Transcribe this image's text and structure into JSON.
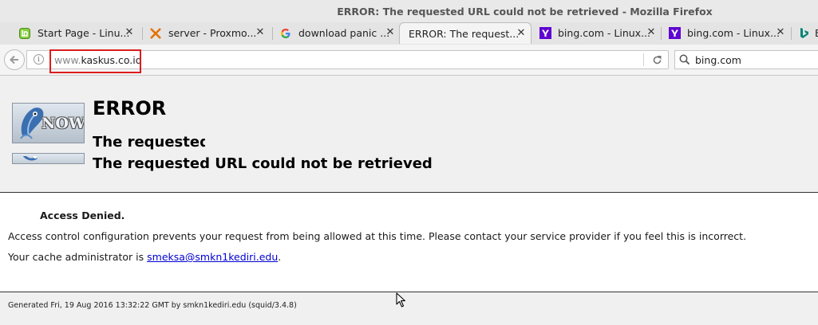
{
  "window": {
    "title": "ERROR: The requested URL could not be retrieved - Mozilla Firefox"
  },
  "tabs": [
    {
      "label": "Start Page - Linu...",
      "icon": "linux-mint-icon",
      "active": false
    },
    {
      "label": "server - Proxmo...",
      "icon": "proxmox-icon",
      "active": false
    },
    {
      "label": "download panic ...",
      "icon": "google-icon",
      "active": false
    },
    {
      "label": "ERROR: The request...",
      "icon": "none",
      "active": true
    },
    {
      "label": "bing.com - Linux...",
      "icon": "yahoo-icon",
      "active": false
    },
    {
      "label": "bing.com - Linux...",
      "icon": "yahoo-icon",
      "active": false
    },
    {
      "label": "B",
      "icon": "bing-icon",
      "active": false
    }
  ],
  "tab_close_glyph": "✕",
  "nav": {
    "url_prefix": "www.",
    "url_host": "kaskus.co.id",
    "search_value": "bing.com"
  },
  "page": {
    "heading": "ERROR",
    "subheading_clipped": "The requested URL could not be retrieved",
    "subheading": "The requested URL could not be retrieved",
    "logo_text": "NOW",
    "denied": "Access Denied.",
    "message": "Access control configuration prevents your request from being allowed at this time. Please contact your service provider if you feel this is incorrect.",
    "admin_prefix": "Your cache administrator is ",
    "admin_email": "smeksa@smkn1kediri.edu",
    "admin_suffix": ".",
    "footer": "Generated Fri, 19 Aug 2016 13:32:22 GMT by smkn1kediri.edu (squid/3.4.8)"
  },
  "colors": {
    "highlight_box": "#dd1c1c",
    "link": "#0000d0"
  }
}
